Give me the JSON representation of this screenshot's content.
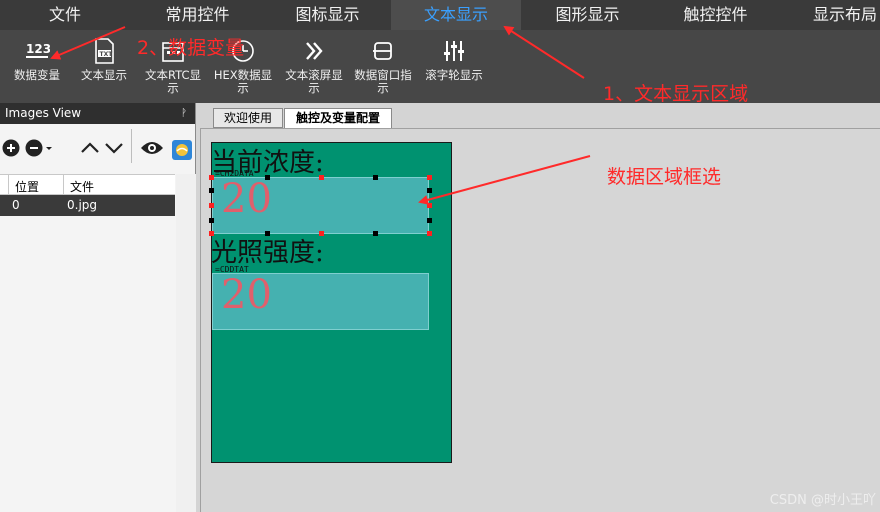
{
  "menu": {
    "items": [
      {
        "label": "文件"
      },
      {
        "label": "常用控件"
      },
      {
        "label": "图标显示"
      },
      {
        "label": "文本显示",
        "active": true
      },
      {
        "label": "图形显示"
      },
      {
        "label": "触控控件"
      },
      {
        "label": "显示布局"
      }
    ]
  },
  "ribbon": {
    "buttons": [
      {
        "label": "数据变量",
        "icon": "number-123-icon"
      },
      {
        "label": "文本显示",
        "icon": "txt-file-icon"
      },
      {
        "label": "文本RTC显示",
        "icon": "calendar-icon"
      },
      {
        "label": "HEX数据显示",
        "icon": "hex-clock-icon"
      },
      {
        "label": "文本滚屏显示",
        "icon": "double-chevron-icon"
      },
      {
        "label": "数据窗口指示",
        "icon": "data-window-icon"
      },
      {
        "label": "滚字轮显示",
        "icon": "slider-bars-icon"
      }
    ]
  },
  "images_view": {
    "title": "Images View",
    "pin": "ᚹ",
    "columns": [
      "位置",
      "文件"
    ],
    "rows": [
      {
        "pos": "0",
        "file": "0.jpg"
      }
    ]
  },
  "tabs": [
    {
      "label": "欢迎使用"
    },
    {
      "label": "触控及变量配置",
      "active": true
    }
  ],
  "screen": {
    "label1": "当前浓度:",
    "var1": "=CH2DATA",
    "value1": "20",
    "label2": "光照强度:",
    "var2": "=CDDTAT",
    "value2": "20"
  },
  "annotations": {
    "a1": "1、文本显示区域",
    "a2": "2、数据变量",
    "a3": "数据区域框选"
  },
  "colors": {
    "annotation": "#ff2a2a",
    "screen_bg": "#009270",
    "data_box": "#45b1b0",
    "data_value": "#e0606c",
    "active_tab_text": "#3aa0ff"
  },
  "watermark": "CSDN @时小王吖"
}
